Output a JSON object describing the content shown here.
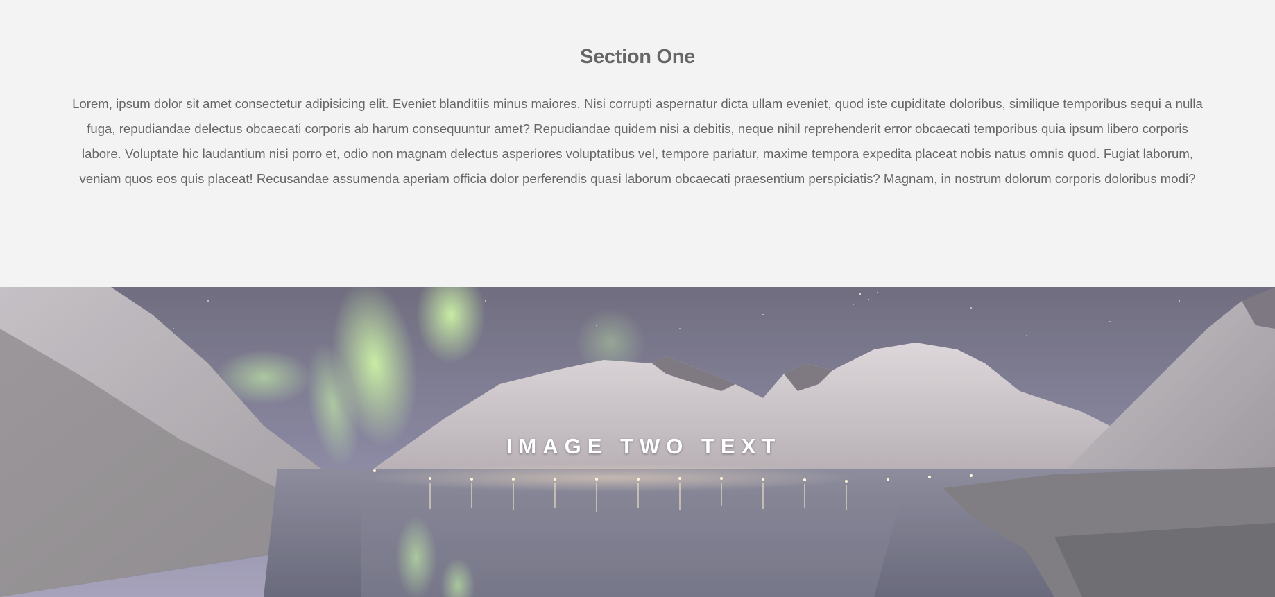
{
  "section_one": {
    "title": "Section One",
    "body": "Lorem, ipsum dolor sit amet consectetur adipisicing elit. Eveniet blanditiis minus maiores. Nisi corrupti aspernatur dicta ullam eveniet, quod iste cupiditate doloribus, similique temporibus sequi a nulla fuga, repudiandae delectus obcaecati corporis ab harum consequuntur amet? Repudiandae quidem nisi a debitis, neque nihil reprehenderit error obcaecati temporibus quia ipsum libero corporis labore. Voluptate hic laudantium nisi porro et, odio non magnam delectus asperiores voluptatibus vel, tempore pariatur, maxime tempora expedita placeat nobis natus omnis quod. Fugiat laborum, veniam quos eos quis placeat! Recusandae assumenda aperiam officia dolor perferendis quasi laborum obcaecati praesentium perspiciatis? Magnam, in nostrum dolorum corporis doloribus modi?"
  },
  "image_two": {
    "caption": "IMAGE TWO TEXT",
    "scene": "aurora-mountain-fjord-image"
  },
  "colors": {
    "page_background": "#f3f3f3",
    "text": "#666666",
    "caption": "#ffffff"
  }
}
